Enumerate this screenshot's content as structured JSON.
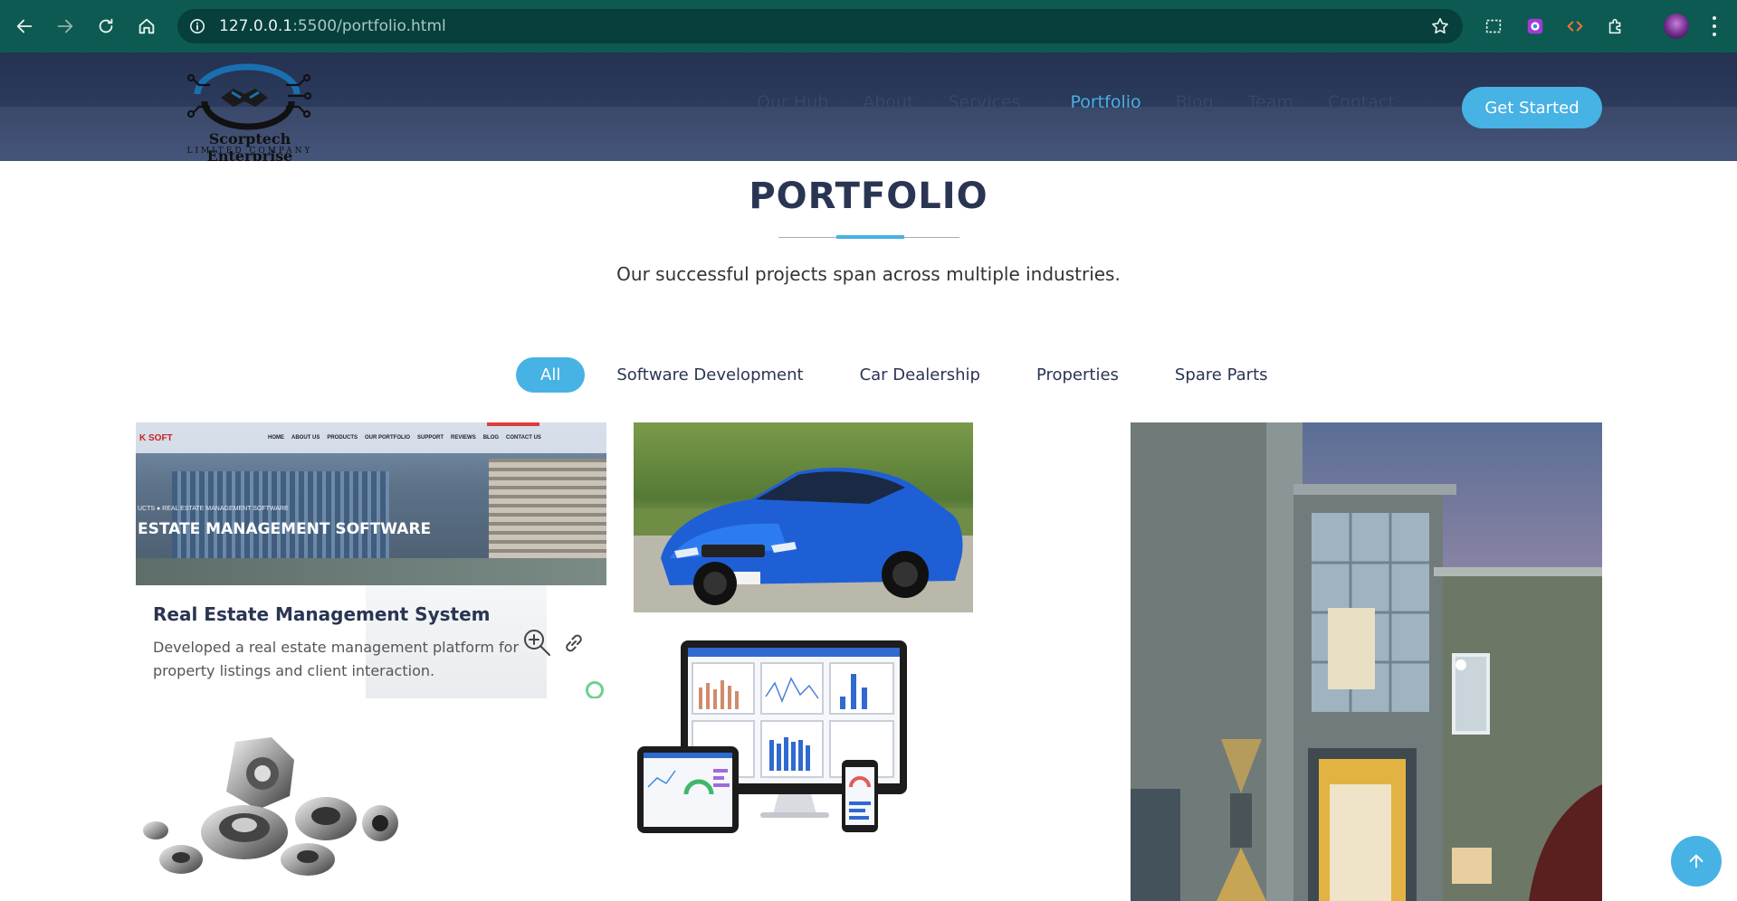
{
  "browser": {
    "url_host": "127.0.0.1",
    "url_path": ":5500/portfolio.html"
  },
  "header": {
    "logo_name": "Scorptech Enterprise",
    "logo_sub": "LIMITED COMPANY",
    "nav": [
      "Our Hub",
      "About",
      "Services",
      "Portfolio",
      "Blog",
      "Team",
      "Contact"
    ],
    "active_nav": "Portfolio",
    "cta_label": "Get Started"
  },
  "portfolio": {
    "title": "PORTFOLIO",
    "subtitle": "Our successful projects span across multiple industries.",
    "filters": [
      "All",
      "Software Development",
      "Car Dealership",
      "Properties",
      "Spare Parts"
    ],
    "active_filter": "All",
    "items": {
      "real_estate": {
        "title": "Real Estate Management System",
        "description": "Developed a real estate management platform for property listings and client interaction.",
        "preview_logo": "K SOFT",
        "preview_menu": [
          "HOME",
          "ABOUT US",
          "PRODUCTS",
          "OUR PORTFOLIO",
          "SUPPORT",
          "REVIEWS",
          "BLOG",
          "CONTACT US"
        ],
        "preview_crumb": "UCTS  ●  REAL ESTATE MANAGEMENT SOFTWARE",
        "preview_heading": "ESTATE MANAGEMENT SOFTWARE"
      }
    }
  },
  "colors": {
    "accent": "#47b2e4",
    "heading": "#2a3553",
    "browser_bar": "#0d5a52"
  }
}
